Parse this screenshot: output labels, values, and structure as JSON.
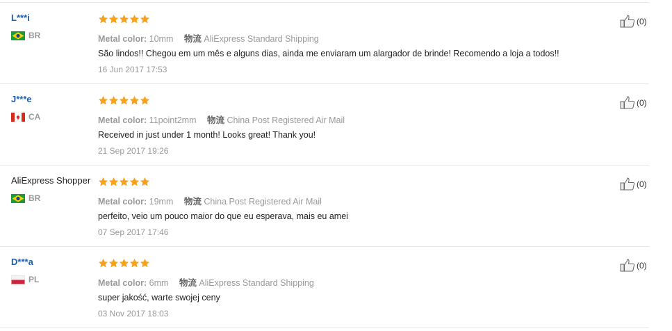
{
  "reviews": [
    {
      "user": "L***i",
      "country": "BR",
      "flag": "brazil-flag",
      "rating": 5,
      "metal_label": "Metal color:",
      "metal_value": "10mm",
      "ship_label": "物流",
      "ship_value": "AliExpress Standard Shipping",
      "comment": "São lindos!! Chegou em um mês e alguns dias, ainda me enviaram um alargador de brinde! Recomendo a loja a todos!!",
      "date": "16 Jun 2017 17:53",
      "helpful": "(0)"
    },
    {
      "user": "J***e",
      "country": "CA",
      "flag": "canada-flag",
      "rating": 5,
      "metal_label": "Metal color:",
      "metal_value": "11point2mm",
      "ship_label": "物流",
      "ship_value": "China Post Registered Air Mail",
      "comment": "Received in just under 1 month! Looks great! Thank you!",
      "date": "21 Sep 2017 19:26",
      "helpful": "(0)"
    },
    {
      "user": "AliExpress Shopper",
      "country": "BR",
      "flag": "brazil-flag",
      "rating": 5,
      "metal_label": "Metal color:",
      "metal_value": "19mm",
      "ship_label": "物流",
      "ship_value": "China Post Registered Air Mail",
      "comment": "perfeito, veio um pouco maior do que eu esperava, mais eu amei",
      "date": "07 Sep 2017 17:46",
      "helpful": "(0)"
    },
    {
      "user": "D***a",
      "country": "PL",
      "flag": "poland-flag",
      "rating": 5,
      "metal_label": "Metal color:",
      "metal_value": "6mm",
      "ship_label": "物流",
      "ship_value": "AliExpress Standard Shipping",
      "comment": "super jakość, warte swojej ceny",
      "date": "03 Nov 2017 18:03",
      "helpful": "(0)"
    }
  ],
  "colors": {
    "star": "#f7a21c",
    "user_link": "#1a5fb4",
    "muted": "#999999"
  }
}
